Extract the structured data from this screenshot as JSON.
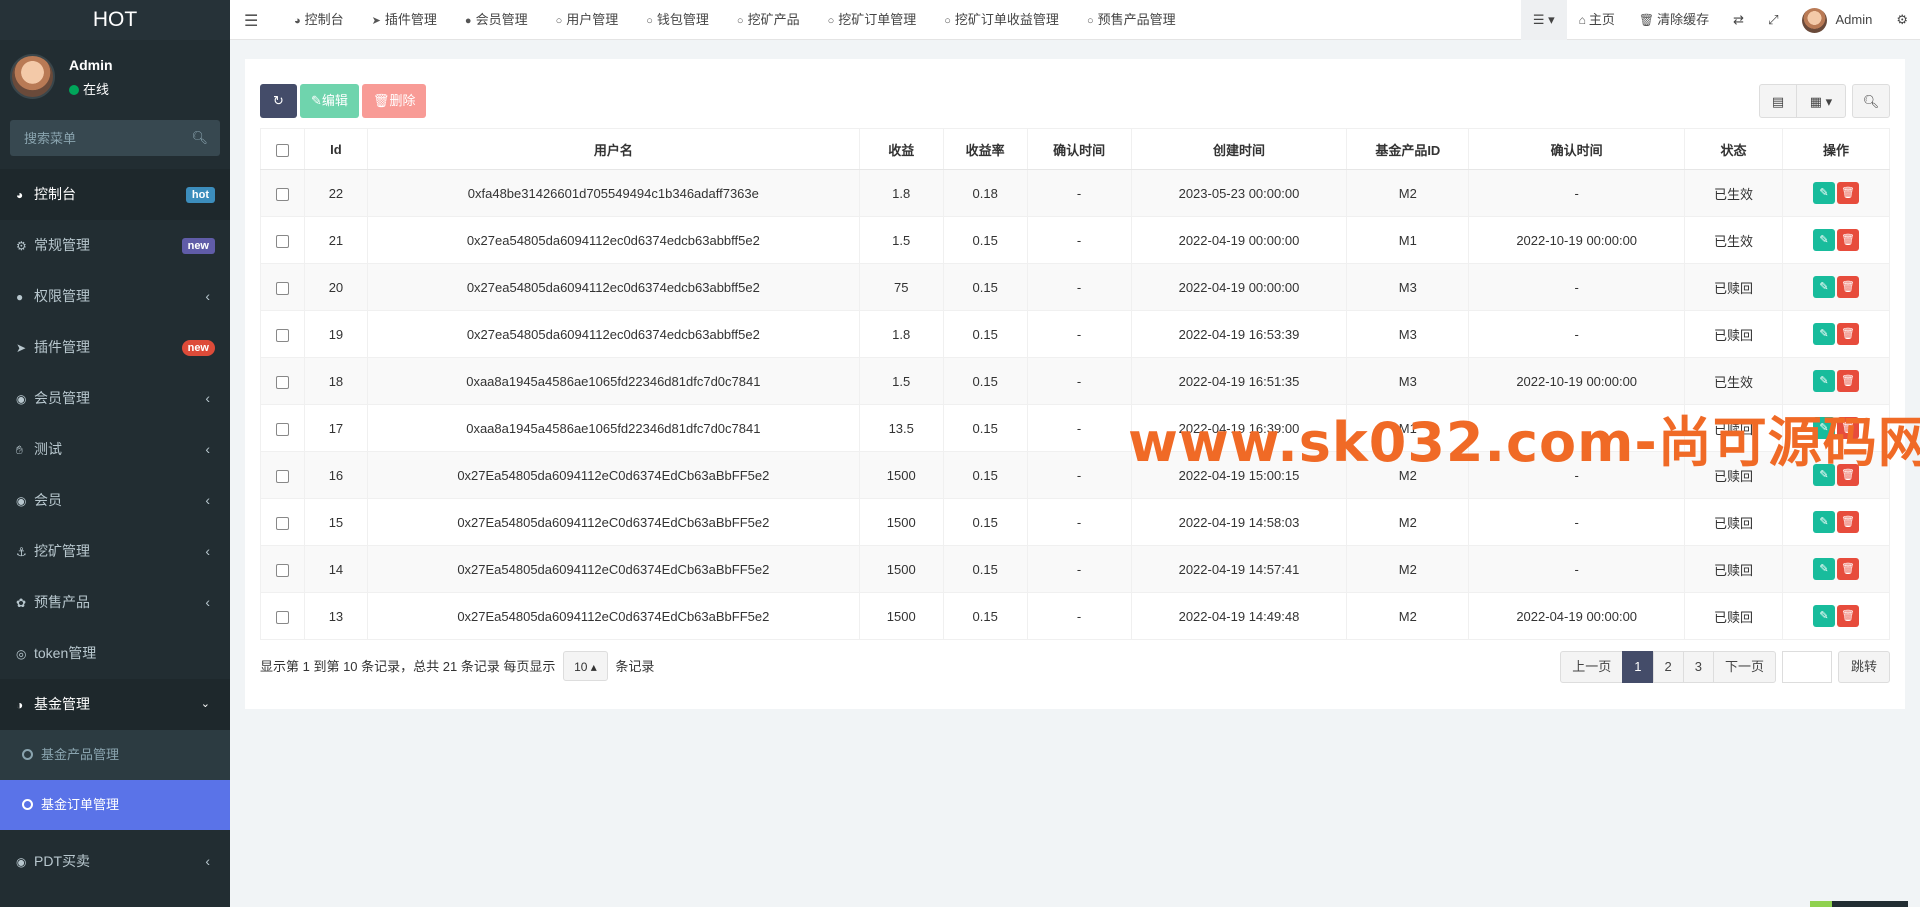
{
  "sidebar": {
    "logo": "HOT",
    "user": {
      "name": "Admin",
      "status": "在线"
    },
    "search_placeholder": "搜索菜单",
    "items": [
      {
        "label": "控制台",
        "icon": "dashboard-icon",
        "badge": "hot"
      },
      {
        "label": "常规管理",
        "icon": "cogs-icon",
        "badge": "new"
      },
      {
        "label": "权限管理",
        "icon": "group-icon"
      },
      {
        "label": "插件管理",
        "icon": "rocket-icon",
        "badge": "new"
      },
      {
        "label": "会员管理",
        "icon": "user-circle-icon"
      },
      {
        "label": "测试",
        "icon": "hand-icon"
      },
      {
        "label": "会员",
        "icon": "user-circle-icon"
      },
      {
        "label": "挖矿管理",
        "icon": "anchor-icon"
      },
      {
        "label": "预售产品",
        "icon": "flower-icon"
      },
      {
        "label": "token管理",
        "icon": "coin-icon"
      },
      {
        "label": "基金管理",
        "icon": "adjust-icon"
      }
    ],
    "fund_sub": [
      {
        "label": "基金产品管理"
      },
      {
        "label": "基金订单管理"
      }
    ],
    "after": [
      {
        "label": "PDT买卖",
        "icon": "compass-icon"
      }
    ]
  },
  "topnav": {
    "items": [
      {
        "label": "控制台",
        "icon": "dashboard-icon"
      },
      {
        "label": "插件管理",
        "icon": "rocket-icon"
      },
      {
        "label": "会员管理",
        "icon": "user-icon"
      },
      {
        "label": "用户管理",
        "icon": "circle-icon"
      },
      {
        "label": "钱包管理",
        "icon": "circle-icon"
      },
      {
        "label": "挖矿产品",
        "icon": "circle-icon"
      },
      {
        "label": "挖矿订单管理",
        "icon": "circle-icon"
      },
      {
        "label": "挖矿订单收益管理",
        "icon": "circle-icon"
      },
      {
        "label": "预售产品管理",
        "icon": "circle-icon"
      }
    ],
    "right": {
      "home": "主页",
      "clear_cache": "清除缓存",
      "admin": "Admin"
    }
  },
  "toolbar": {
    "edit": "编辑",
    "delete": "删除"
  },
  "table": {
    "headers": [
      "Id",
      "用户名",
      "收益",
      "收益率",
      "确认时间",
      "创建时间",
      "基金产品ID",
      "确认时间",
      "状态",
      "操作"
    ],
    "rows": [
      [
        "22",
        "0xfa48be31426601d705549494c1b346adaff7363e",
        "1.8",
        "0.18",
        "-",
        "2023-05-23 00:00:00",
        "M2",
        "-",
        "已生效"
      ],
      [
        "21",
        "0x27ea54805da6094112ec0d6374edcb63abbff5e2",
        "1.5",
        "0.15",
        "-",
        "2022-04-19 00:00:00",
        "M1",
        "2022-10-19 00:00:00",
        "已生效"
      ],
      [
        "20",
        "0x27ea54805da6094112ec0d6374edcb63abbff5e2",
        "75",
        "0.15",
        "-",
        "2022-04-19 00:00:00",
        "M3",
        "-",
        "已赎回"
      ],
      [
        "19",
        "0x27ea54805da6094112ec0d6374edcb63abbff5e2",
        "1.8",
        "0.15",
        "-",
        "2022-04-19 16:53:39",
        "M3",
        "-",
        "已赎回"
      ],
      [
        "18",
        "0xaa8a1945a4586ae1065fd22346d81dfc7d0c7841",
        "1.5",
        "0.15",
        "-",
        "2022-04-19 16:51:35",
        "M3",
        "2022-10-19 00:00:00",
        "已生效"
      ],
      [
        "17",
        "0xaa8a1945a4586ae1065fd22346d81dfc7d0c7841",
        "13.5",
        "0.15",
        "-",
        "2022-04-19 16:39:00",
        "M1",
        "",
        "已赎回"
      ],
      [
        "16",
        "0x27Ea54805da6094112eC0d6374EdCb63aBbFF5e2",
        "1500",
        "0.15",
        "-",
        "2022-04-19 15:00:15",
        "M2",
        "-",
        "已赎回"
      ],
      [
        "15",
        "0x27Ea54805da6094112eC0d6374EdCb63aBbFF5e2",
        "1500",
        "0.15",
        "-",
        "2022-04-19 14:58:03",
        "M2",
        "-",
        "已赎回"
      ],
      [
        "14",
        "0x27Ea54805da6094112eC0d6374EdCb63aBbFF5e2",
        "1500",
        "0.15",
        "-",
        "2022-04-19 14:57:41",
        "M2",
        "-",
        "已赎回"
      ],
      [
        "13",
        "0x27Ea54805da6094112eC0d6374EdCb63aBbFF5e2",
        "1500",
        "0.15",
        "-",
        "2022-04-19 14:49:48",
        "M2",
        "2022-04-19 00:00:00",
        "已赎回"
      ]
    ]
  },
  "pager": {
    "info_prefix": "显示第 1 到第 10 条记录，总共 21 条记录 每页显示",
    "page_size": "10",
    "info_suffix": "条记录",
    "prev": "上一页",
    "pages": [
      "1",
      "2",
      "3"
    ],
    "next": "下一页",
    "jump": "跳转"
  },
  "watermark": "www.sk032.com-尚可源码网"
}
